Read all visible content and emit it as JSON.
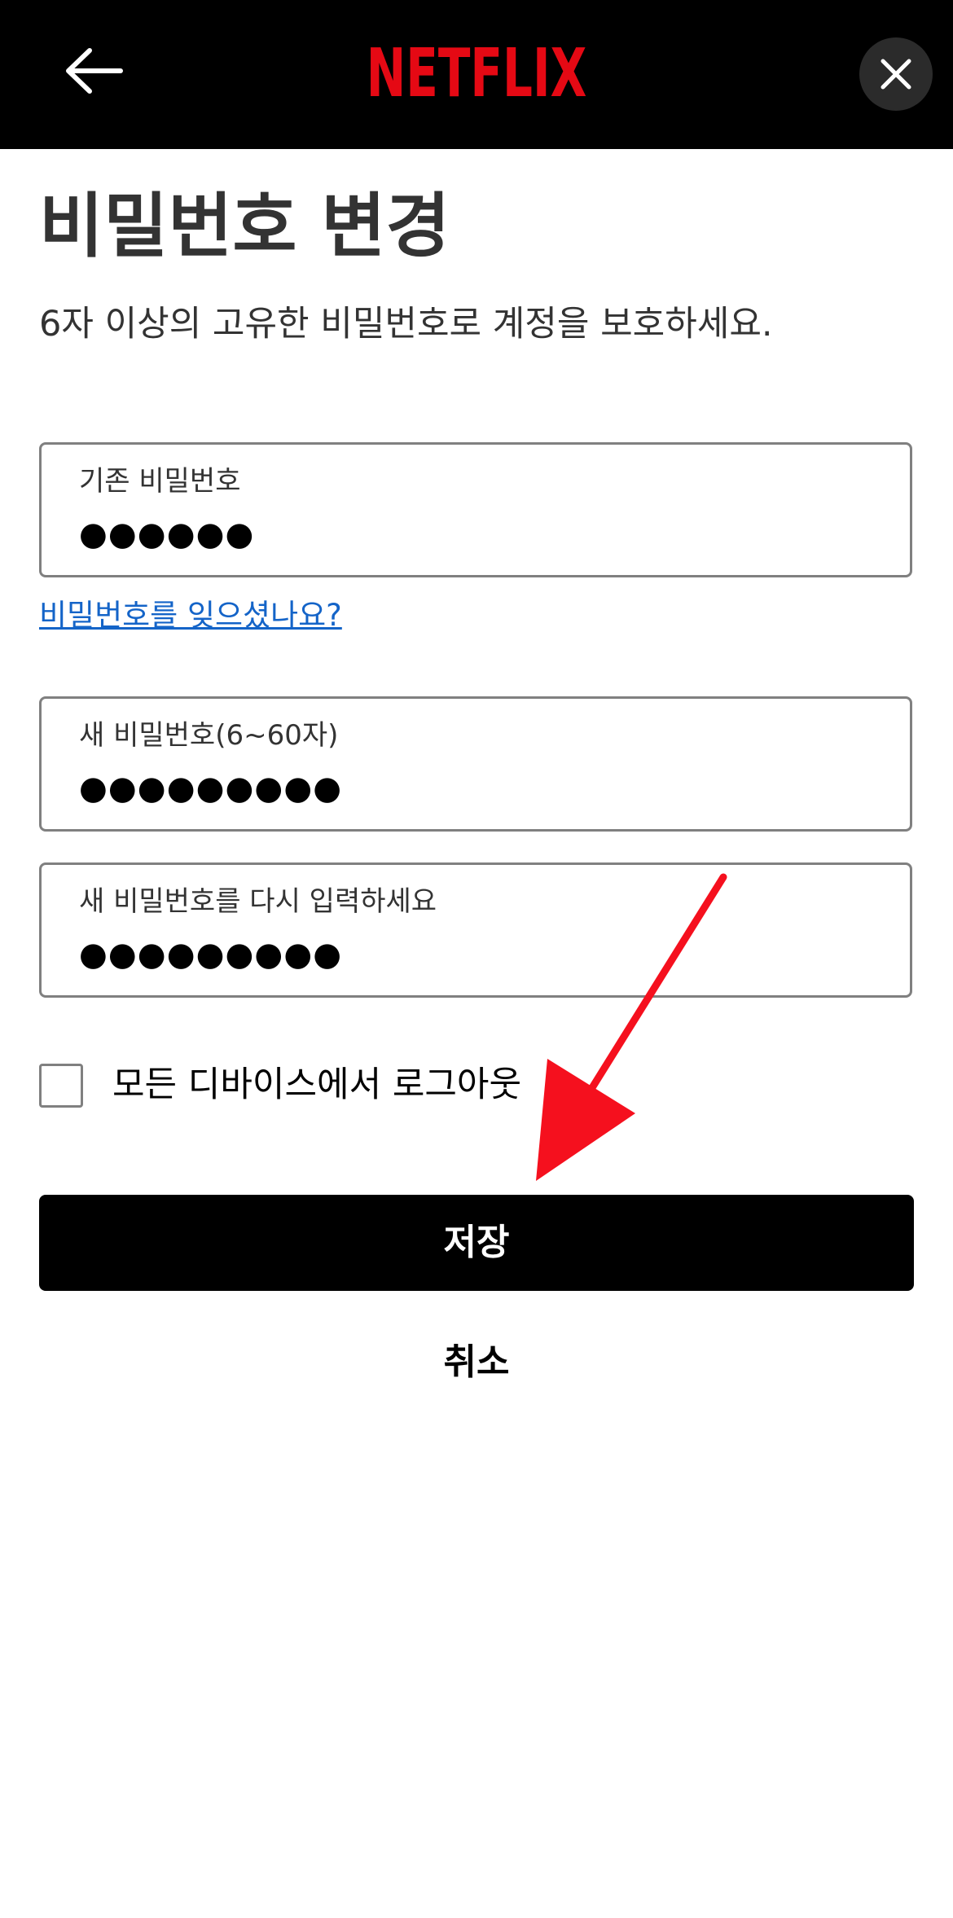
{
  "header": {
    "logo_text": "NETFLIX",
    "back_icon": "arrow-left-icon",
    "close_icon": "close-icon",
    "brand_color": "#e50914"
  },
  "page": {
    "title": "비밀번호 변경",
    "subtitle": "6자 이상의 고유한 비밀번호로 계정을 보호하세요."
  },
  "fields": {
    "current_password": {
      "label": "기존 비밀번호",
      "value": "●●●●●●"
    },
    "forgot_link": "비밀번호를 잊으셨나요?",
    "new_password": {
      "label": "새 비밀번호(6~60자)",
      "value": "●●●●●●●●●"
    },
    "confirm_password": {
      "label": "새 비밀번호를 다시 입력하세요",
      "value": "●●●●●●●●●"
    }
  },
  "logout_all": {
    "label": "모든 디바이스에서 로그아웃",
    "checked": false
  },
  "actions": {
    "save_label": "저장",
    "cancel_label": "취소"
  },
  "annotation": {
    "arrow_color": "#f5101e",
    "icon": "red-arrow-annotation"
  }
}
